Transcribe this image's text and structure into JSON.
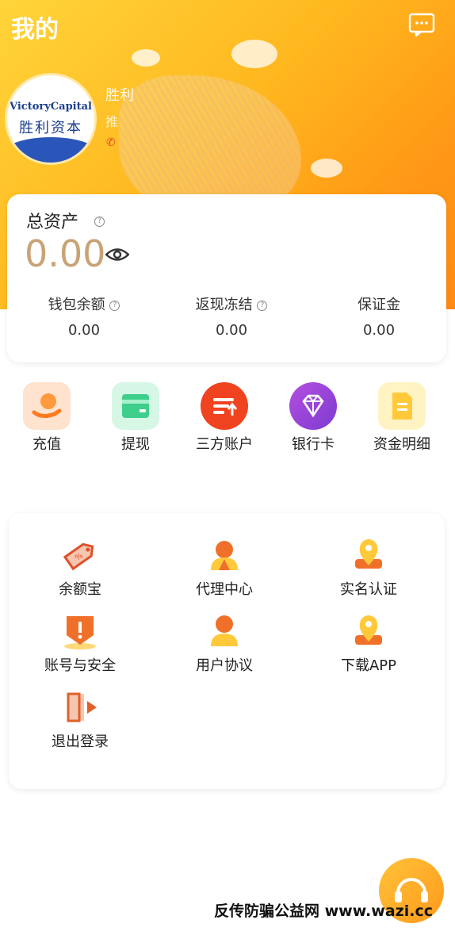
{
  "header": {
    "title": "我的"
  },
  "profile": {
    "logo_text": "VictoryCapital",
    "logo_cn": "胜利资本",
    "name": "胜利",
    "subtitle": "推"
  },
  "assets": {
    "label": "总资产",
    "total": "0.00",
    "stats": [
      {
        "label": "钱包余额",
        "value": "0.00"
      },
      {
        "label": "返现冻结",
        "value": "0.00"
      },
      {
        "label": "保证金",
        "value": "0.00"
      }
    ]
  },
  "quick_actions": [
    {
      "label": "充值",
      "icon": "recharge-icon",
      "color": "#ff8a3d"
    },
    {
      "label": "提现",
      "icon": "wallet-icon",
      "color": "#3fcf8c"
    },
    {
      "label": "三方账户",
      "icon": "card-upload-icon",
      "color": "#f0431f"
    },
    {
      "label": "银行卡",
      "icon": "diamond-icon",
      "color": "#8e44d8"
    },
    {
      "label": "资金明细",
      "icon": "document-icon",
      "color": "#ffc93a"
    }
  ],
  "menu_items": [
    {
      "label": "余额宝",
      "icon": "tag-icon"
    },
    {
      "label": "代理中心",
      "icon": "agent-icon"
    },
    {
      "label": "实名认证",
      "icon": "location-pin-icon"
    },
    {
      "label": "账号与安全",
      "icon": "shield-alert-icon"
    },
    {
      "label": "用户协议",
      "icon": "user-icon"
    },
    {
      "label": "下载APP",
      "icon": "download-pin-icon"
    },
    {
      "label": "退出登录",
      "icon": "logout-icon"
    }
  ],
  "footer": {
    "watermark": "反传防骗公益网 www.wazi.cc"
  }
}
